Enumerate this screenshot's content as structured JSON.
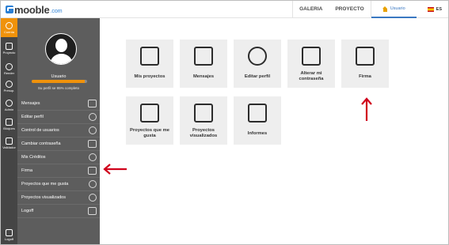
{
  "brand": {
    "name": "mooble",
    "domain": ".com",
    "accent": "#2a7fd4"
  },
  "topnav": {
    "gallery": "GALERIA",
    "project": "PROYECTO",
    "user": "Usuario",
    "lang": "ES"
  },
  "rail": [
    {
      "label": "Cuenta",
      "icon": "user-circle-icon",
      "active": true
    },
    {
      "label": "Proyecto",
      "icon": "project-icon",
      "active": false
    },
    {
      "label": "Render",
      "icon": "teapot-icon",
      "active": false
    },
    {
      "label": "Presup.",
      "icon": "dollar-icon",
      "active": false
    },
    {
      "label": "Admin",
      "icon": "gear-icon",
      "active": false
    },
    {
      "label": "Bloques",
      "icon": "cubes-icon",
      "active": false
    },
    {
      "label": "Validador",
      "icon": "validator-icon",
      "active": false
    }
  ],
  "rail_bottom": {
    "label": "Logoff"
  },
  "profile": {
    "username": "Usuario",
    "progress_percent": 95,
    "completion_text": "Su perfil se 95% completo",
    "accent": "#f0920b"
  },
  "menu": [
    {
      "label": "Mensajes",
      "icon": "envelope-icon"
    },
    {
      "label": "Editar perfil",
      "icon": "edit-profile-icon"
    },
    {
      "label": "Control de usuarios",
      "icon": "users-control-icon"
    },
    {
      "label": "Cambiar contraseña",
      "icon": "lock-icon"
    },
    {
      "label": "Mis Créditos",
      "icon": "money-bag-icon"
    },
    {
      "label": "Firma",
      "icon": "signature-icon"
    },
    {
      "label": "Proyectos que me gusta",
      "icon": "liked-projects-icon"
    },
    {
      "label": "Proyectos visualizados",
      "icon": "viewed-projects-icon"
    },
    {
      "label": "Logoff",
      "icon": "logout-icon"
    }
  ],
  "tiles": [
    {
      "label": "Mis proyectos",
      "icon": "map-fold-icon"
    },
    {
      "label": "Mensajes",
      "icon": "envelope-icon"
    },
    {
      "label": "Editar perfil",
      "icon": "edit-profile-icon"
    },
    {
      "label": "Alterar mi contraseña",
      "icon": "lock-icon"
    },
    {
      "label": "Firma",
      "icon": "signature-icon"
    },
    {
      "label": "Proyectos que me gusta",
      "icon": "heart-map-icon"
    },
    {
      "label": "Proyectos visualizados",
      "icon": "eye-map-icon"
    },
    {
      "label": "Informes",
      "icon": "report-icon"
    }
  ],
  "annotation_color": "#d0021b"
}
